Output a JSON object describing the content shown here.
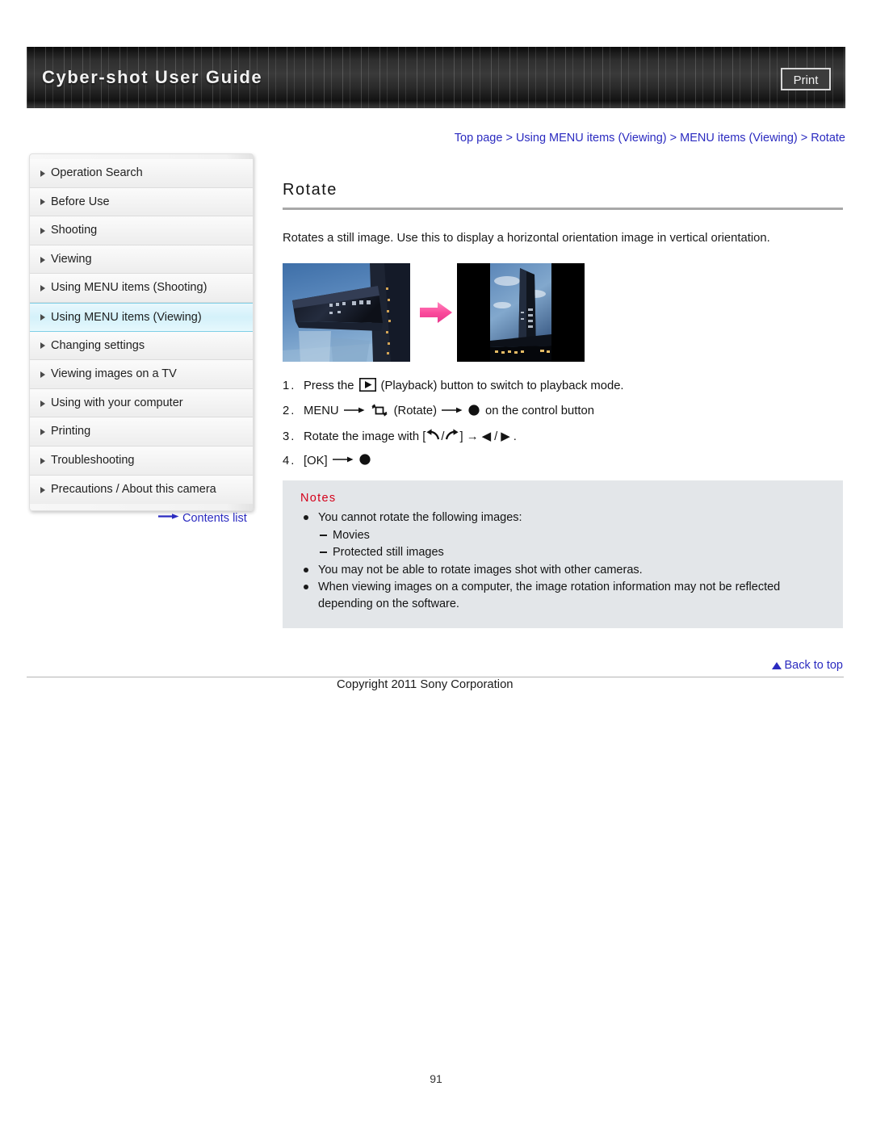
{
  "header": {
    "title": "Cyber-shot User Guide",
    "print_label": "Print"
  },
  "breadcrumb": {
    "full": "Top page > Using MENU items (Viewing) > MENU items (Viewing) > Rotate",
    "items": [
      "Top page",
      "Using MENU items (Viewing)",
      "MENU items (Viewing)",
      "Rotate"
    ],
    "separator": ">"
  },
  "sidebar": {
    "items": [
      {
        "label": "Operation Search",
        "selected": false
      },
      {
        "label": "Before Use",
        "selected": false
      },
      {
        "label": "Shooting",
        "selected": false
      },
      {
        "label": "Viewing",
        "selected": false
      },
      {
        "label": "Using MENU items (Shooting)",
        "selected": false
      },
      {
        "label": "Using MENU items (Viewing)",
        "selected": true
      },
      {
        "label": "Changing settings",
        "selected": false
      },
      {
        "label": "Viewing images on a TV",
        "selected": false
      },
      {
        "label": "Using with your computer",
        "selected": false
      },
      {
        "label": "Printing",
        "selected": false
      },
      {
        "label": "Troubleshooting",
        "selected": false
      },
      {
        "label": "Precautions / About this camera",
        "selected": false
      }
    ],
    "contents_link": "Contents list"
  },
  "main": {
    "title": "Rotate",
    "intro": "Rotates a still image. Use this to display a horizontal orientation image in vertical orientation.",
    "figure": {
      "before_alt": "horizontal-orientation-building-photo",
      "after_alt": "vertical-orientation-building-photo",
      "arrow_color": "#ff4d9e"
    },
    "steps": [
      {
        "num": "1.",
        "pre": "Press the",
        "icon": "playback-icon",
        "post": "(Playback) button to switch to playback mode."
      },
      {
        "num": "2.",
        "pre": "MENU",
        "icon": "rotate-icon",
        "mid": "(Rotate)",
        "post": "on the control button"
      },
      {
        "num": "3.",
        "pre": "Rotate the image with [",
        "post": "] → ◀ / ▶ ."
      },
      {
        "num": "4.",
        "pre": "[OK]",
        "post": ""
      }
    ],
    "notes": {
      "title": "Notes",
      "items": [
        {
          "text": "You cannot rotate the following images:",
          "sub": [
            "Movies",
            "Protected still images"
          ]
        },
        {
          "text": "You may not be able to rotate images shot with other cameras.",
          "sub": []
        },
        {
          "text": "When viewing images on a computer, the image rotation information may not be reflected depending on the software.",
          "sub": []
        }
      ]
    }
  },
  "footer": {
    "back_to_top": "Back to top",
    "copyright": "Copyright 2011 Sony Corporation",
    "page_number": "91"
  },
  "colors": {
    "link": "#2b2bc0",
    "notes_title": "#d4001a",
    "notes_bg": "#e3e6e9",
    "selected_nav": "#d4f1fa",
    "arrow_pink": "#ff4d9e"
  }
}
